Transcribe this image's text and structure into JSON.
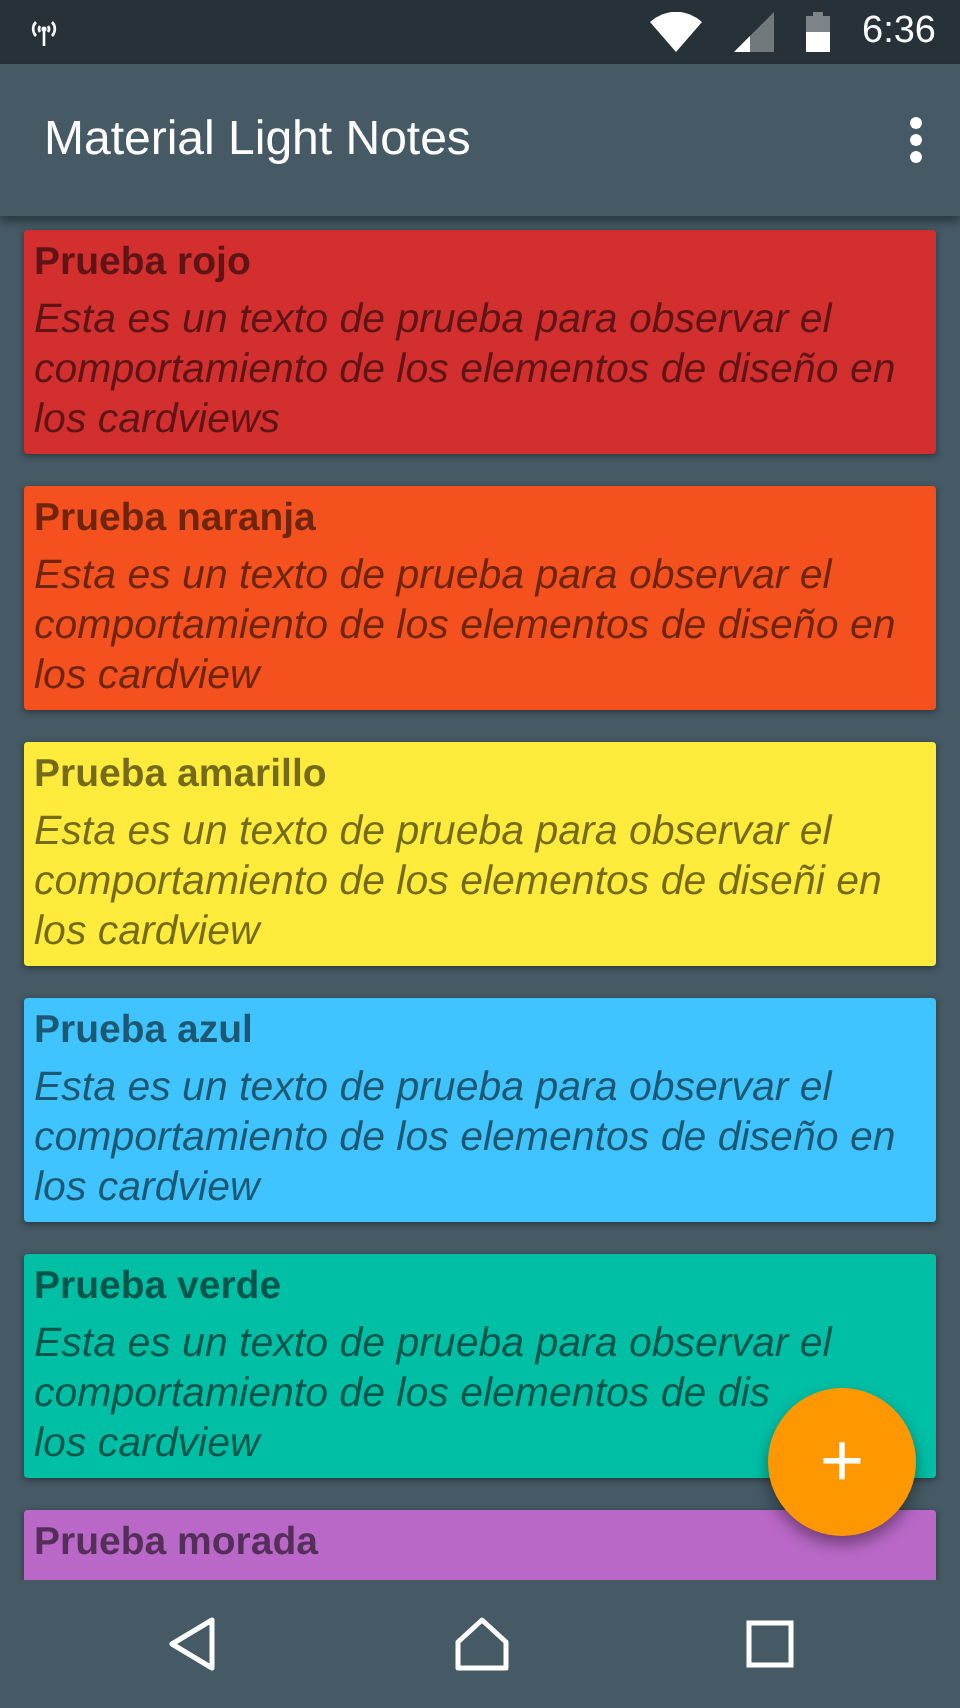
{
  "status_bar": {
    "time": "6:36"
  },
  "app_bar": {
    "title": "Material Light Notes"
  },
  "notes": [
    {
      "title": "Prueba rojo",
      "color": "#d32f2f",
      "body_lines": [
        "Esta es un texto de prueba para observar el",
        "comportamiento de los elementos de diseño en",
        "los cardviews"
      ]
    },
    {
      "title": "Prueba naranja",
      "color": "#f4511e",
      "body_lines": [
        "Esta es un texto de prueba para observar el",
        "comportamiento de los elementos de diseño en",
        "los cardview"
      ]
    },
    {
      "title": "Prueba amarillo",
      "color": "#ffeb3b",
      "body_lines": [
        "Esta es un texto de prueba para observar el",
        "comportamiento de los elementos de diseñi en",
        "los cardview"
      ]
    },
    {
      "title": "Prueba azul",
      "color": "#40c4ff",
      "body_lines": [
        "Esta es un texto de prueba para observar el",
        "comportamiento de los elementos de diseño en",
        "los cardview"
      ]
    },
    {
      "title": "Prueba verde",
      "color": "#00bfa5",
      "body_lines": [
        "Esta es un texto de prueba para observar el",
        "comportamiento de los elementos de dis",
        "los cardview"
      ]
    },
    {
      "title": "Prueba morada",
      "color": "#ba68c8"
    }
  ],
  "fab": {
    "label": "+"
  }
}
